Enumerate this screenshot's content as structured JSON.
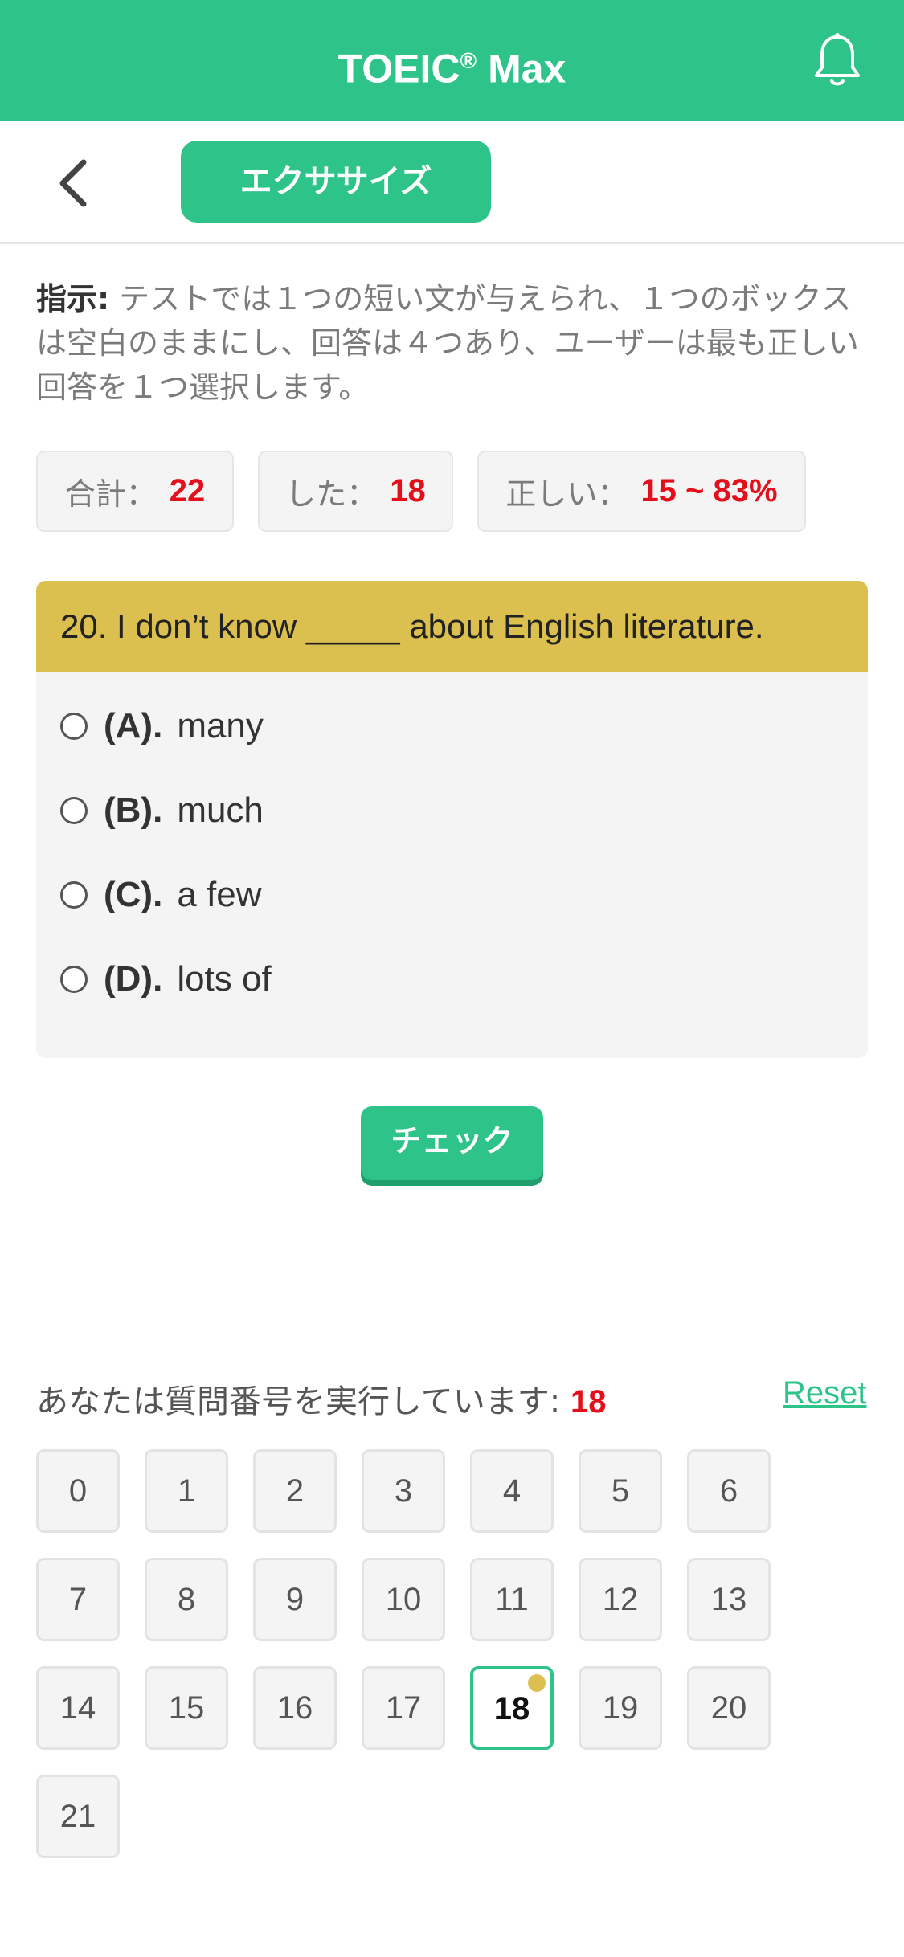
{
  "app": {
    "title": "TOEIC",
    "title_mark": "®",
    "title_suffix": "Max",
    "brand_color": "#2ec489"
  },
  "nav": {
    "back_icon": "chevron-left-icon",
    "notification_icon": "bell-icon",
    "exercise_label": "エクササイズ"
  },
  "instructions": {
    "label": "指示:",
    "text": "テストでは１つの短い文が与えられ、１つのボックスは空白のままにし、回答は４つあり、ユーザーは最も正しい回答を１つ選択します。"
  },
  "stats": {
    "total_label": "合計：",
    "total_value": "22",
    "done_label": "した：",
    "done_value": "18",
    "correct_label": "正しい：",
    "correct_value": "15 ~ 83%"
  },
  "question": {
    "text": "20. I don’t know _____ about English literature.",
    "options": [
      {
        "letter": "(A).",
        "text": "many"
      },
      {
        "letter": "(B).",
        "text": "much"
      },
      {
        "letter": "(C).",
        "text": "a few"
      },
      {
        "letter": "(D).",
        "text": "lots of"
      }
    ]
  },
  "check_label": "チェック",
  "progress": {
    "label": "あなたは質問番号を実行しています:",
    "current": "18",
    "reset_label": "Reset"
  },
  "question_numbers": [
    "0",
    "1",
    "2",
    "3",
    "4",
    "5",
    "6",
    "7",
    "8",
    "9",
    "10",
    "11",
    "12",
    "13",
    "14",
    "15",
    "16",
    "17",
    "18",
    "19",
    "20",
    "21"
  ],
  "active_index": 18,
  "colors": {
    "accent": "#2ec489",
    "question_header": "#dbbf4f",
    "highlight_red": "#e3101c"
  }
}
